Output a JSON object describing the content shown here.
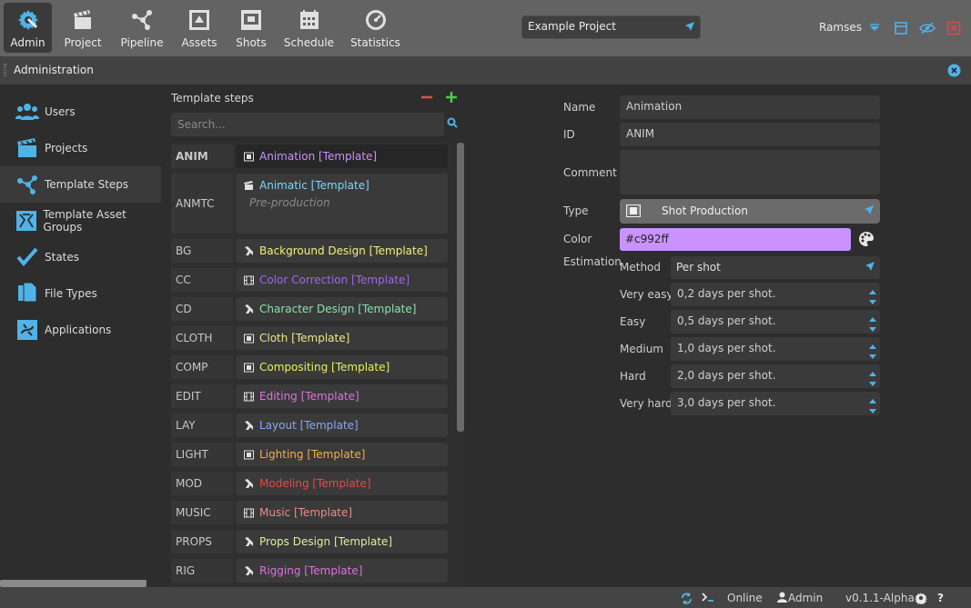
{
  "toolbar": {
    "tools": [
      {
        "label": "Admin",
        "icon": "admin-gear-icon",
        "active": true
      },
      {
        "label": "Project",
        "icon": "clapperboard-icon"
      },
      {
        "label": "Pipeline",
        "icon": "pipeline-nodes-icon"
      },
      {
        "label": "Assets",
        "icon": "asset-box-icon"
      },
      {
        "label": "Shots",
        "icon": "shot-frame-icon"
      },
      {
        "label": "Schedule",
        "icon": "calendar-icon"
      },
      {
        "label": "Statistics",
        "icon": "gauge-icon"
      }
    ],
    "project": "Example Project",
    "user": "Ramses"
  },
  "panel": {
    "title": "Administration"
  },
  "sidebar": {
    "items": [
      {
        "label": "Users",
        "icon": "users-icon"
      },
      {
        "label": "Projects",
        "icon": "clapperboard-icon"
      },
      {
        "label": "Template Steps",
        "icon": "pipeline-nodes-icon",
        "active": true
      },
      {
        "label": "Template Asset Groups",
        "icon": "asset-group-icon"
      },
      {
        "label": "States",
        "icon": "checkmark-icon"
      },
      {
        "label": "File Types",
        "icon": "files-icon"
      },
      {
        "label": "Applications",
        "icon": "application-icon"
      }
    ]
  },
  "steps": {
    "title": "Template steps",
    "search_placeholder": "Search...",
    "rows": [
      {
        "id": "ANIM",
        "name": "Animation [Template]",
        "color": "#c992ff",
        "icon": "shot-film-icon",
        "selected": true
      },
      {
        "id": "ANMTC",
        "name": "Animatic [Template]",
        "color": "#7fd6ff",
        "icon": "clapperboard-icon",
        "desc": "Pre-production"
      },
      {
        "id": "BG",
        "name": "Background Design [Template]",
        "color": "#f2f078",
        "icon": "asset-piece-icon"
      },
      {
        "id": "CC",
        "name": "Color Correction [Template]",
        "color": "#a066f0",
        "icon": "film-strip-icon"
      },
      {
        "id": "CD",
        "name": "Character Design [Template]",
        "color": "#8ce0b0",
        "icon": "asset-piece-icon"
      },
      {
        "id": "CLOTH",
        "name": "Cloth [Template]",
        "color": "#e8e890",
        "icon": "shot-film-icon"
      },
      {
        "id": "COMP",
        "name": "Compositing [Template]",
        "color": "#e8f05a",
        "icon": "shot-film-icon"
      },
      {
        "id": "EDIT",
        "name": "Editing [Template]",
        "color": "#e070e0",
        "icon": "film-strip-icon"
      },
      {
        "id": "LAY",
        "name": "Layout [Template]",
        "color": "#8aa8f0",
        "icon": "asset-piece-icon"
      },
      {
        "id": "LIGHT",
        "name": "Lighting [Template]",
        "color": "#f0b04a",
        "icon": "shot-film-icon"
      },
      {
        "id": "MOD",
        "name": "Modeling [Template]",
        "color": "#e84848",
        "icon": "asset-piece-icon"
      },
      {
        "id": "MUSIC",
        "name": "Music [Template]",
        "color": "#f08a8a",
        "icon": "film-strip-icon"
      },
      {
        "id": "PROPS",
        "name": "Props Design [Template]",
        "color": "#d8f0a0",
        "icon": "asset-piece-icon"
      },
      {
        "id": "RIG",
        "name": "Rigging [Template]",
        "color": "#e070e0",
        "icon": "asset-piece-icon"
      }
    ]
  },
  "detail": {
    "name_label": "Name",
    "name_value": "Animation",
    "id_label": "ID",
    "id_value": "ANIM",
    "comment_label": "Comment",
    "comment_value": "",
    "type_label": "Type",
    "type_value": "Shot Production",
    "color_label": "Color",
    "color_value": "#c992ff",
    "estimation_label": "Estimation",
    "method_label": "Method",
    "method_value": "Per shot",
    "levels": [
      {
        "label": "Very easy",
        "value": "0,2 days per shot."
      },
      {
        "label": "Easy",
        "value": "0,5 days per shot."
      },
      {
        "label": "Medium",
        "value": "1,0 days per shot."
      },
      {
        "label": "Hard",
        "value": "2,0 days per shot."
      },
      {
        "label": "Very hard",
        "value": "3,0 days per shot."
      }
    ]
  },
  "status": {
    "online": "Online",
    "user": "Admin",
    "version": "v0.1.1-Alpha"
  },
  "colors": {
    "accent": "#4fb3e8",
    "close_red": "#e04848",
    "add_green": "#4ccb4c",
    "remove_red": "#e05050"
  }
}
